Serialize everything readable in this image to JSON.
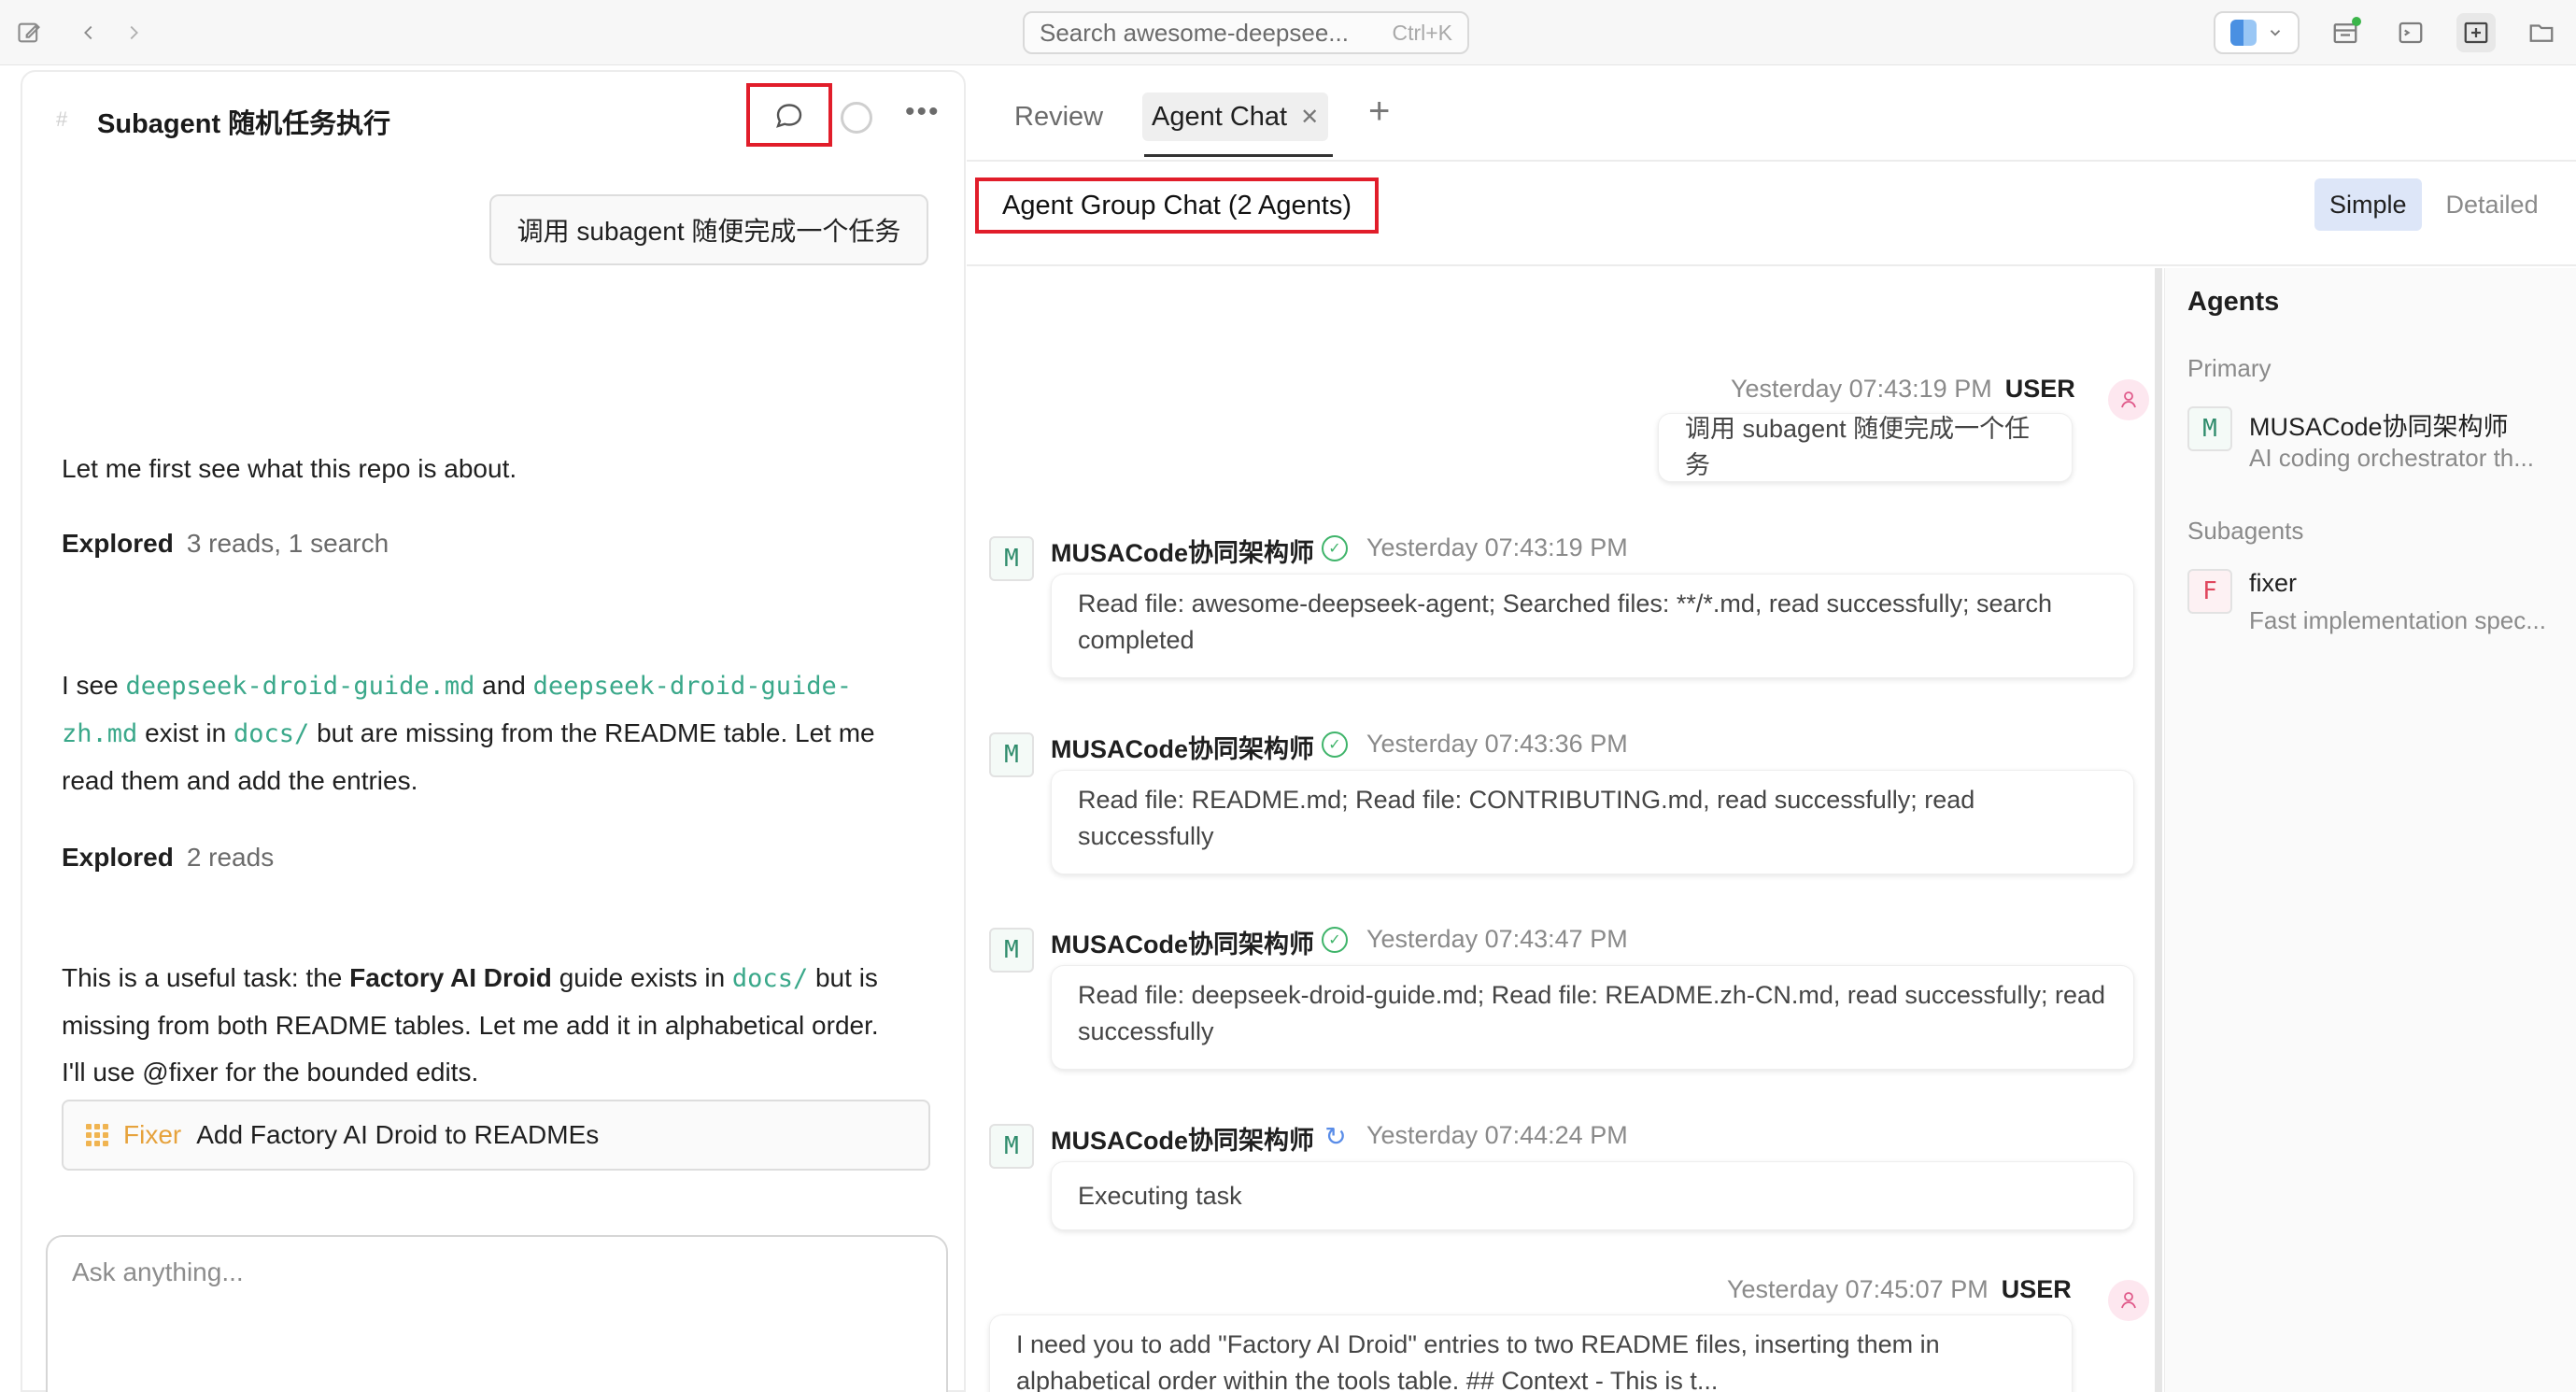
{
  "topbar": {
    "search_placeholder": "Search awesome-deepsee...",
    "search_shortcut": "Ctrl+K",
    "icons": [
      "compose-icon",
      "back-icon",
      "forward-icon",
      "finder-icon",
      "chevron-down-icon",
      "layout-icon",
      "terminal-icon",
      "split-icon",
      "folder-icon"
    ]
  },
  "left": {
    "title": "Subagent 随机任务执行",
    "user_message": "调用 subagent 随便完成一个任务",
    "para1": "Let me first see what this repo is about.",
    "explored1_label": "Explored",
    "explored1_value": "3 reads, 1 search",
    "para2_a": "I see",
    "para2_link1": "deepseek-droid-guide.md",
    "para2_b": "and",
    "para2_link2a": "deepseek-droid-guide-",
    "para2_link2b": "zh.md",
    "para2_c": "exist in",
    "para2_link3": "docs/",
    "para2_d": "but are missing from the README table. Let me",
    "para2_e": "read them and add the entries.",
    "explored2_label": "Explored",
    "explored2_value": "2 reads",
    "para3_a": "This is a useful task: the",
    "para3_bold": "Factory AI Droid",
    "para3_b": "guide exists in",
    "para3_link": "docs/",
    "para3_c": "but is",
    "para3_line2": "missing from both README tables. Let me add it in alphabetical order.",
    "para3_line3": "I'll use @fixer for the bounded edits.",
    "task_agent": "Fixer",
    "task_title": "Add Factory AI Droid to READMEs",
    "composer_placeholder": "Ask anything..."
  },
  "right": {
    "tabs": [
      {
        "label": "Review"
      },
      {
        "label": "Agent Chat"
      }
    ],
    "group_title": "Agent Group Chat (2 Agents)",
    "modes": [
      "Simple",
      "Detailed"
    ],
    "active_mode": "Simple",
    "messages": [
      {
        "type": "user",
        "time": "Yesterday 07:43:19 PM",
        "who": "USER",
        "text": "调用 subagent 随便完成一个任务"
      },
      {
        "type": "agent",
        "avatar": "M",
        "name": "MUSACode协同架构师",
        "status": "done",
        "time": "Yesterday 07:43:19 PM",
        "text": "Read file: awesome-deepseek-agent; Searched files: **/*.md, read successfully; search completed"
      },
      {
        "type": "agent",
        "avatar": "M",
        "name": "MUSACode协同架构师",
        "status": "done",
        "time": "Yesterday 07:43:36 PM",
        "text": "Read file: README.md; Read file: CONTRIBUTING.md, read successfully; read successfully"
      },
      {
        "type": "agent",
        "avatar": "M",
        "name": "MUSACode协同架构师",
        "status": "done",
        "time": "Yesterday 07:43:47 PM",
        "text": "Read file: deepseek-droid-guide.md; Read file: README.zh-CN.md, read successfully; read successfully"
      },
      {
        "type": "agent",
        "avatar": "M",
        "name": "MUSACode协同架构师",
        "status": "running",
        "time": "Yesterday 07:44:24 PM",
        "text": "Executing task"
      },
      {
        "type": "user",
        "time": "Yesterday 07:45:07 PM",
        "who": "USER",
        "text": "I need you to add \"Factory AI Droid\" entries to two README files, inserting them in alphabetical order within the tools table. ## Context - This is t..."
      }
    ],
    "agents_panel": {
      "title": "Agents",
      "primary_label": "Primary",
      "primary": {
        "avatar": "M",
        "name": "MUSACode协同架构师",
        "desc": "AI coding orchestrator th..."
      },
      "subagents_label": "Subagents",
      "subagent": {
        "avatar": "F",
        "name": "fixer",
        "desc": "Fast implementation spec..."
      }
    }
  },
  "colors": {
    "highlight_box": "#e11d2a",
    "code_link": "#3aa88a",
    "fixer_accent": "#e6a23c",
    "status_ok": "#3fb46a",
    "status_running": "#5a8de8"
  }
}
